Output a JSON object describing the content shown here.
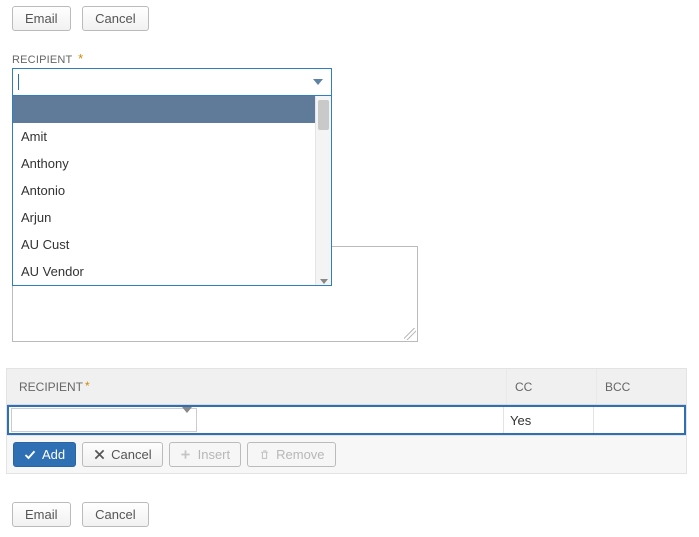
{
  "top_buttons": {
    "email": "Email",
    "cancel": "Cancel"
  },
  "recipient_field": {
    "label": "RECIPIENT",
    "required_marker": "*",
    "value": "",
    "options": [
      "",
      "Amit",
      "Anthony",
      "Antonio",
      "Arjun",
      "AU Cust",
      "AU Vendor"
    ],
    "selected_index": 0
  },
  "note_area": {
    "value": ""
  },
  "grid": {
    "columns": {
      "recipient": "RECIPIENT",
      "required_marker": "*",
      "cc": "CC",
      "bcc": "BCC"
    },
    "row": {
      "recipient_value": "",
      "cc_value": "Yes",
      "bcc_value": ""
    },
    "actions": {
      "add": "Add",
      "cancel": "Cancel",
      "insert": "Insert",
      "remove": "Remove"
    }
  },
  "bottom_buttons": {
    "email": "Email",
    "cancel": "Cancel"
  },
  "colors": {
    "focus_border": "#2f7fbf",
    "primary": "#2f70b5",
    "dropdown_selected_bg": "#607a99"
  }
}
